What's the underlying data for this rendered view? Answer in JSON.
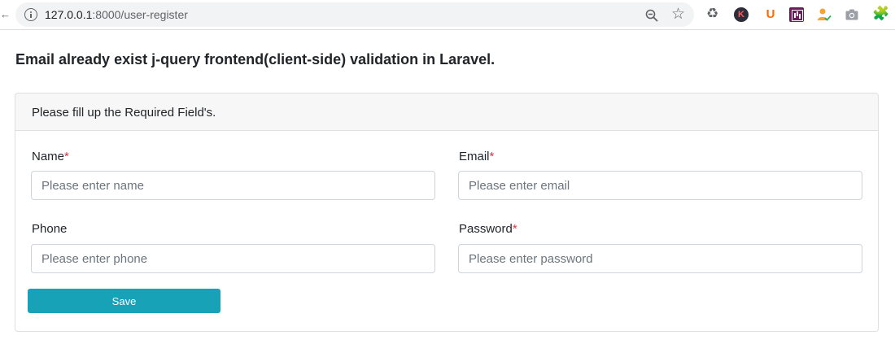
{
  "browser": {
    "url_host": "127.0.0.1",
    "url_path": ":8000/user-register",
    "icons": {
      "info": "info-icon",
      "zoom": "zoom-icon",
      "bookmark": "star-icon",
      "extensions": [
        "recycle-icon",
        "k-extension-icon",
        "u-extension-icon",
        "chart-extension-icon",
        "user-check-icon",
        "camera-icon",
        "puzzle-icon"
      ]
    },
    "ext_k_label": "K",
    "ext_u_label": "U"
  },
  "page": {
    "title_plain": "Email already exist ",
    "title_bold": "j-query frontend(client-side) validation in Laravel."
  },
  "card": {
    "header": "Please fill up the Required Field's.",
    "fields": {
      "name": {
        "label": "Name",
        "required_mark": "*",
        "placeholder": "Please enter name"
      },
      "email": {
        "label": "Email",
        "required_mark": "*",
        "placeholder": "Please enter email"
      },
      "phone": {
        "label": "Phone",
        "placeholder": "Please enter phone"
      },
      "password": {
        "label": "Password",
        "required_mark": "*",
        "placeholder": "Please enter password"
      }
    },
    "save_label": "Save"
  },
  "colors": {
    "accent": "#17a2b8",
    "required": "#dc3545"
  }
}
